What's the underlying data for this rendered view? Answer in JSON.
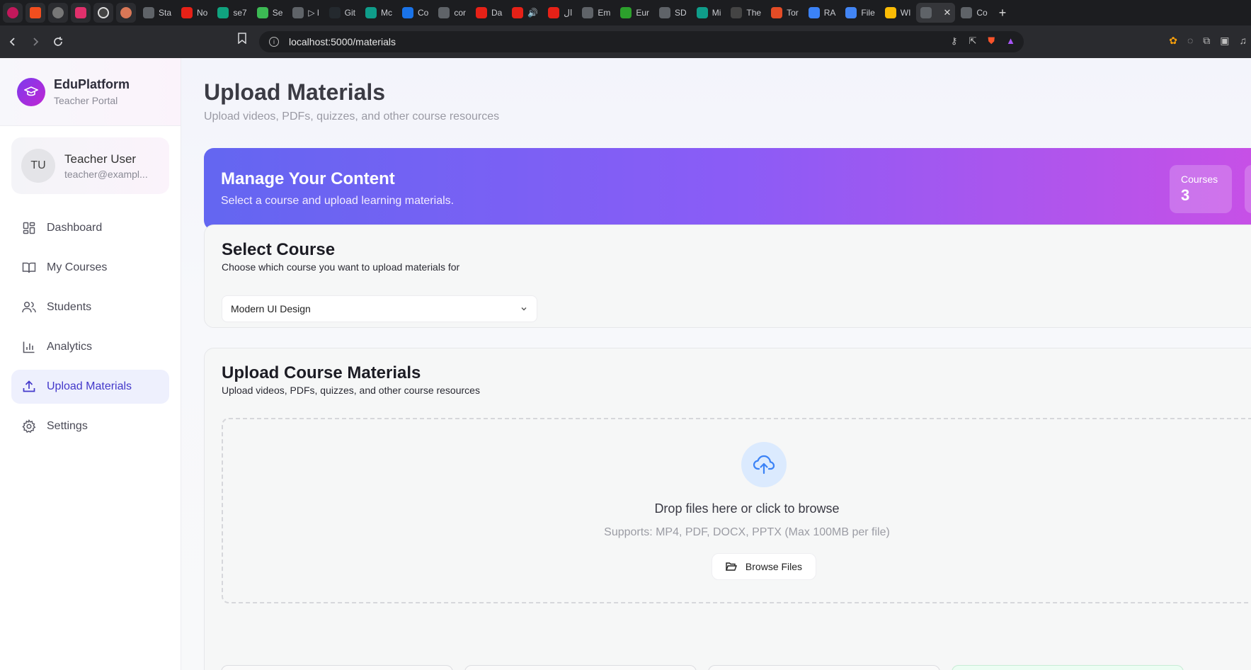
{
  "browser": {
    "tabs": [
      {
        "label": "Sta",
        "color": "#5f6368"
      },
      {
        "label": "No",
        "color": "#e62117"
      },
      {
        "label": "se7",
        "color": "#10a37f"
      },
      {
        "label": "Se",
        "color": "#3cba54"
      },
      {
        "label": "▷ l",
        "color": "#5f6368"
      },
      {
        "label": "Git",
        "color": "#24292e"
      },
      {
        "label": "Mc",
        "color": "#0f9d8a"
      },
      {
        "label": "Co",
        "color": "#1a73e8"
      },
      {
        "label": "cor",
        "color": "#5f6368"
      },
      {
        "label": "Da",
        "color": "#e62117"
      },
      {
        "label": "🔊",
        "color": "#e62117"
      },
      {
        "label": "ال",
        "color": "#e62117"
      },
      {
        "label": "Em",
        "color": "#5f6368"
      },
      {
        "label": "Eur",
        "color": "#2ca02c"
      },
      {
        "label": "SD",
        "color": "#5f6368"
      },
      {
        "label": "Mi",
        "color": "#0f9d8a"
      },
      {
        "label": "The",
        "color": "#444"
      },
      {
        "label": "Tor",
        "color": "#e34c26"
      },
      {
        "label": "RA",
        "color": "#3b82f6"
      },
      {
        "label": "File",
        "color": "#4285f4"
      },
      {
        "label": "WI",
        "color": "#fbbc05"
      },
      {
        "label": "",
        "color": "#5f6368",
        "active": true
      },
      {
        "label": "Co",
        "color": "#5f6368"
      }
    ],
    "url": "localhost:5000/materials"
  },
  "brand": {
    "name": "EduPlatform",
    "subtitle": "Teacher Portal"
  },
  "user": {
    "initials": "TU",
    "name": "Teacher User",
    "email": "teacher@exampl..."
  },
  "nav": [
    {
      "label": "Dashboard",
      "icon": "dashboard-icon"
    },
    {
      "label": "My Courses",
      "icon": "book-icon"
    },
    {
      "label": "Students",
      "icon": "users-icon"
    },
    {
      "label": "Analytics",
      "icon": "bar-chart-icon"
    },
    {
      "label": "Upload Materials",
      "icon": "upload-icon",
      "active": true
    },
    {
      "label": "Settings",
      "icon": "gear-icon"
    }
  ],
  "header": {
    "title": "Upload Materials",
    "subtitle": "Upload videos, PDFs, quizzes, and other course resources"
  },
  "banner": {
    "title": "Manage Your Content",
    "subtitle": "Select a course and upload learning materials.",
    "stats": [
      {
        "label": "Courses",
        "value": "3"
      }
    ]
  },
  "select_course": {
    "title": "Select Course",
    "subtitle": "Choose which course you want to upload materials for",
    "selected": "Modern UI Design"
  },
  "upload": {
    "title": "Upload Course Materials",
    "subtitle": "Upload videos, PDFs, quizzes, and other course resources",
    "drop_title": "Drop files here or click to browse",
    "drop_sub": "Supports: MP4, PDF, DOCX, PPTX (Max 100MB per file)",
    "browse_label": "Browse Files"
  },
  "colors": {
    "accent": "#4338ca",
    "brand_gradient_start": "#6366f1",
    "brand_gradient_end": "#c850e6"
  }
}
